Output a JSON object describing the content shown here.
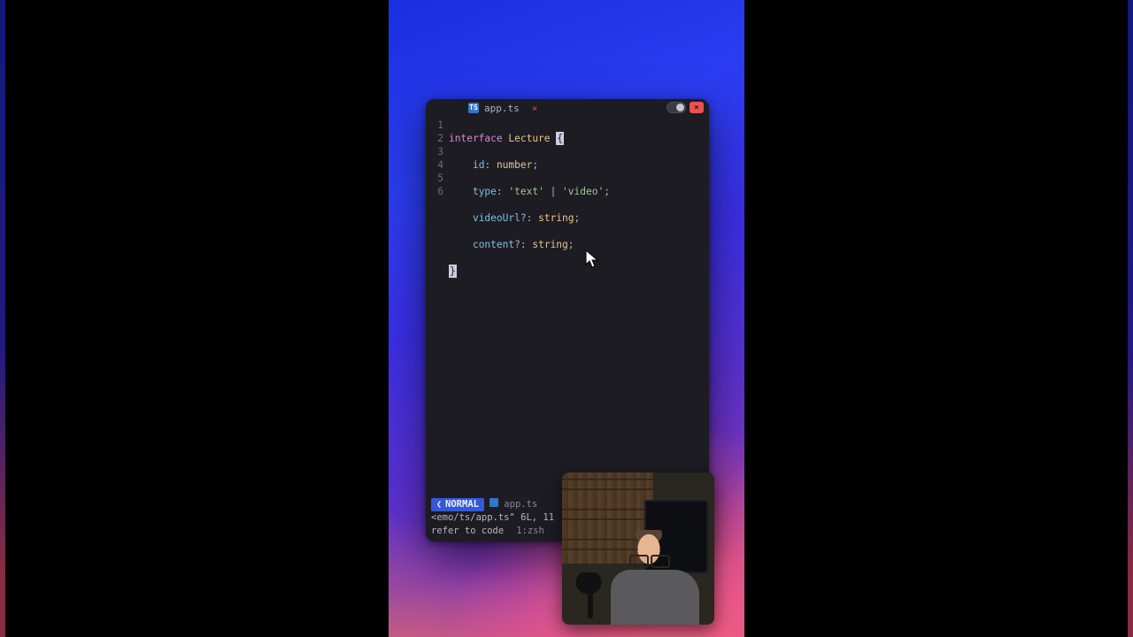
{
  "tab": {
    "icon_label": "TS",
    "filename": "app.ts",
    "close_glyph": "×"
  },
  "window_controls": {
    "close_glyph": "×"
  },
  "code": {
    "lines": [
      {
        "num": "1"
      },
      {
        "num": "2"
      },
      {
        "num": "3"
      },
      {
        "num": "4"
      },
      {
        "num": "5"
      },
      {
        "num": "6"
      }
    ],
    "l1": {
      "kw": "interface",
      "type": "Lecture",
      "brace": "{"
    },
    "l2": {
      "prop": "id",
      "colon": ":",
      "type": "number",
      "semi": ";"
    },
    "l3": {
      "prop": "type",
      "colon": ":",
      "s1": "'text'",
      "pipe": " | ",
      "s2": "'video'",
      "semi": ";"
    },
    "l4": {
      "prop": "videoUrl",
      "opt": "?",
      "colon": ":",
      "type": "string",
      "semi": ";"
    },
    "l5": {
      "prop": "content",
      "opt": "?",
      "colon": ":",
      "type": "string",
      "semi": ";"
    },
    "l6": {
      "brace": "}"
    }
  },
  "status": {
    "mode": "NORMAL",
    "mode_glyph": "❮",
    "file": "app.ts",
    "path_line": "<emo/ts/app.ts\" 6L, 11",
    "bottom": {
      "left": "refer to code",
      "right": "1:zsh"
    }
  }
}
